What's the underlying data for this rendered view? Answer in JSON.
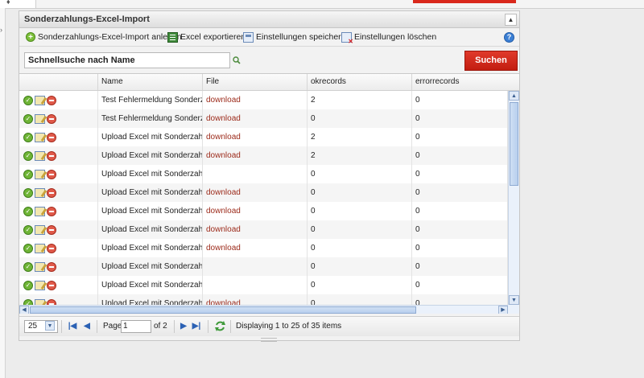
{
  "panel": {
    "title": "Sonderzahlungs-Excel-Import",
    "collapse_icon": "triangle-up-icon"
  },
  "toolbar": {
    "add_label": "Sonderzahlungs-Excel-Import anlegen",
    "export_label": "Excel exportieren",
    "save_settings_label": "Einstellungen speichern",
    "delete_settings_label": "Einstellungen löschen"
  },
  "search": {
    "value": "Schnellsuche nach Name",
    "button_label": "Suchen"
  },
  "columns": [
    "",
    "Name",
    "File",
    "okrecords",
    "errorrecords"
  ],
  "rows": [
    {
      "name": "Test Fehlermeldung Sonderzahlungen",
      "file": "download",
      "ok": "2",
      "err": "0"
    },
    {
      "name": "Test Fehlermeldung Sonderzahlungen",
      "file": "download",
      "ok": "0",
      "err": "0"
    },
    {
      "name": "Upload Excel mit Sonderzahlungen",
      "file": "download",
      "ok": "2",
      "err": "0"
    },
    {
      "name": "Upload Excel mit Sonderzahlungen",
      "file": "download",
      "ok": "2",
      "err": "0"
    },
    {
      "name": "Upload Excel mit Sonderzahlungen",
      "file": "",
      "ok": "0",
      "err": "0"
    },
    {
      "name": "Upload Excel mit Sonderzahlungen",
      "file": "download",
      "ok": "0",
      "err": "0"
    },
    {
      "name": "Upload Excel mit Sonderzahlungen",
      "file": "download",
      "ok": "0",
      "err": "0"
    },
    {
      "name": "Upload Excel mit Sonderzahlungen",
      "file": "download",
      "ok": "0",
      "err": "0"
    },
    {
      "name": "Upload Excel mit Sonderzahlungen",
      "file": "download",
      "ok": "0",
      "err": "0"
    },
    {
      "name": "Upload Excel mit Sonderzahlungen",
      "file": "",
      "ok": "0",
      "err": "0"
    },
    {
      "name": "Upload Excel mit Sonderzahlungen",
      "file": "",
      "ok": "0",
      "err": "0"
    },
    {
      "name": "Upload Excel mit Sonderzahlungen",
      "file": "download",
      "ok": "0",
      "err": "0"
    }
  ],
  "row_action_icons": [
    "check-icon",
    "edit-icon",
    "delete-icon"
  ],
  "pager": {
    "page_size": "25",
    "page_label": "Page",
    "page_value": "1",
    "page_of": "of 2",
    "display_info": "Displaying 1 to 25 of 35 items"
  },
  "colors": {
    "accent_red": "#d9281b",
    "download_link": "#9c2a1a",
    "scroll_blue": "#b8cfee"
  }
}
